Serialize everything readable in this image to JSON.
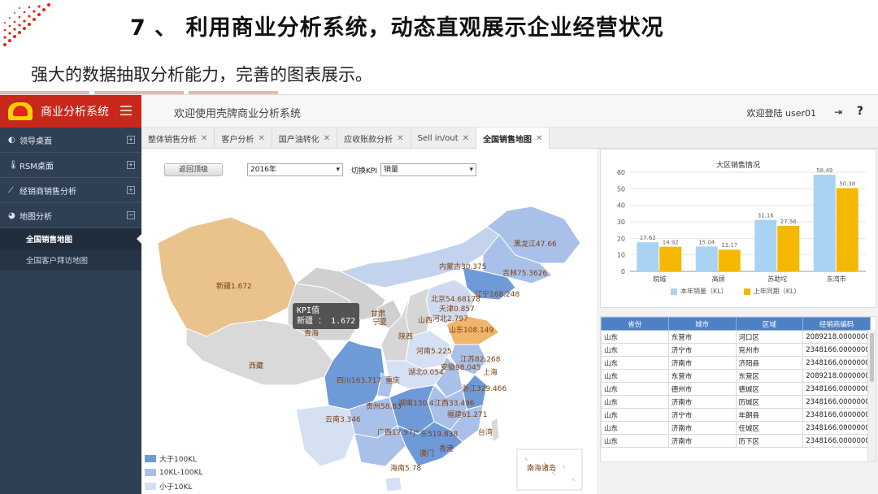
{
  "slide": {
    "title": "7 、 利用商业分析系统，动态直观展示企业经营状况",
    "subtitle": "强大的数据抽取分析能力，完善的图表展示。"
  },
  "app": {
    "brand_name": "商业分析系统",
    "logo_text": "壳牌中国",
    "welcome": "欢迎使用壳牌商业分析系统",
    "user_info": "欢迎登陆 user01",
    "help": "?",
    "accent_color": "#c8281b"
  },
  "sidebar": {
    "items": [
      {
        "label": "领导桌面",
        "icon": "palette-icon"
      },
      {
        "label": "RSM桌面",
        "icon": "thermometer-icon"
      },
      {
        "label": "经销商销售分析",
        "icon": "line-chart-icon"
      },
      {
        "label": "地图分析",
        "icon": "pie-chart-icon"
      }
    ],
    "subitems": [
      {
        "label": "全国销售地图",
        "active": true
      },
      {
        "label": "全国客户拜访地图",
        "active": false
      }
    ]
  },
  "tabs": [
    {
      "label": "整体销售分析",
      "active": false
    },
    {
      "label": "客户分析",
      "active": false
    },
    {
      "label": "国产油转化",
      "active": false
    },
    {
      "label": "应收账款分析",
      "active": false
    },
    {
      "label": "Sell in/out",
      "active": false
    },
    {
      "label": "全国销售地图",
      "active": true
    }
  ],
  "controls": {
    "back_button": "返回顶级",
    "year_value": "2016年",
    "kpi_label": "切换KPI",
    "kpi_value": "销量"
  },
  "map": {
    "tooltip_title": "KPI值",
    "tooltip_value": "新疆 ： 1.672",
    "labels": [
      "新疆1.672",
      "西藏",
      "青海",
      "甘肃",
      "宁夏",
      "陕西",
      "山西",
      "内蒙古30.375",
      "黑龙江47.66",
      "吉林75.3626",
      "辽宁168.248",
      "北京54.68178",
      "天津0.857",
      "河北2.797",
      "山东108.149",
      "河南5.225",
      "江苏82.268",
      "安徽98.045",
      "湖北0.054",
      "上海",
      "四川163.717",
      "重庆",
      "贵州58.83",
      "湖南130.4",
      "江西33.496",
      "浙江329.466",
      "福建61.271",
      "云南3.346",
      "广西17.97",
      "广东519.838",
      "香港",
      "澳门",
      "台湾",
      "海南5.78",
      "南海诸岛"
    ],
    "legend": [
      {
        "label": "大于100KL",
        "color": "#6f9ad8"
      },
      {
        "label": "10KL-100KL",
        "color": "#a9c0e8"
      },
      {
        "label": "小于10KL",
        "color": "#d5e0f2"
      }
    ]
  },
  "chart_data": {
    "type": "bar",
    "title": "大区销售情况",
    "categories": [
      "皖城",
      "高顾",
      "苏助坨",
      "东湾市"
    ],
    "series": [
      {
        "name": "本年销量（KL）",
        "values": [
          17.62,
          15.04,
          31.16,
          58.49
        ],
        "color": "#a9d3f2"
      },
      {
        "name": "上年同期（KL）",
        "values": [
          14.92,
          13.17,
          27.56,
          50.38
        ],
        "color": "#f5b800"
      }
    ],
    "yticks": [
      0,
      10,
      20,
      30,
      40,
      50,
      60
    ],
    "ylim": [
      0,
      60
    ],
    "grid": true,
    "legend_position": "bottom"
  },
  "table": {
    "columns": [
      "省份",
      "城市",
      "区域",
      "经销商编码"
    ],
    "rows": [
      [
        "山东",
        "东营市",
        "河口区",
        "2089218.00000000"
      ],
      [
        "山东",
        "济宁市",
        "兖州市",
        "2348166.00000000"
      ],
      [
        "山东",
        "济南市",
        "济阳县",
        "2348166.00000000"
      ],
      [
        "山东",
        "东营市",
        "东营区",
        "2089218.00000000"
      ],
      [
        "山东",
        "德州市",
        "德城区",
        "2348166.00000000"
      ],
      [
        "山东",
        "济南市",
        "历城区",
        "2348166.00000000"
      ],
      [
        "山东",
        "济宁市",
        "年朗县",
        "2348166.00000000"
      ],
      [
        "山东",
        "济南市",
        "任城区",
        "2348166.00000000"
      ],
      [
        "山东",
        "济南市",
        "历下区",
        "2348166.00000000"
      ]
    ]
  }
}
